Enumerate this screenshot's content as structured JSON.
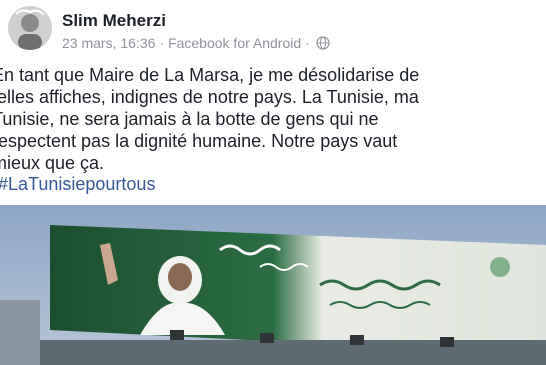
{
  "post": {
    "author": "Slim Meherzi",
    "timestamp": "23 mars, 16:36",
    "separator": "·",
    "source": "Facebook for Android",
    "audience_icon": "globe-icon",
    "text_lines": [
      "En tant que Maire de La Marsa, je me désolidarise de",
      "telles affiches, indignes de notre pays. La Tunisie, ma",
      "Tunisie, ne sera jamais à la botte de gens qui ne",
      "respectent pas la dignité humaine. Notre pays vaut",
      "mieux que ça."
    ],
    "hashtag": "#LaTunisiepourtous"
  },
  "colors": {
    "text": "#1d2129",
    "meta": "#90949c",
    "link": "#365899",
    "billboard_green": "#1f5a34"
  }
}
